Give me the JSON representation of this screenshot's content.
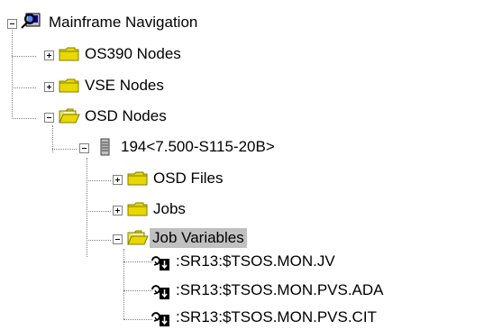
{
  "tree": {
    "root": {
      "label": "Mainframe Navigation",
      "icon": "mainframe-navigation-icon",
      "expanded": true
    },
    "os390": {
      "label": "OS390 Nodes",
      "icon": "folder-icon",
      "expanded": false
    },
    "vse": {
      "label": "VSE Nodes",
      "icon": "folder-icon",
      "expanded": false
    },
    "osd": {
      "label": "OSD Nodes",
      "icon": "open-folder-icon",
      "expanded": true
    },
    "host": {
      "label": "194<7.500-S115-20B>",
      "icon": "server-icon",
      "expanded": true
    },
    "osd_files": {
      "label": "OSD Files",
      "icon": "folder-icon",
      "expanded": false
    },
    "jobs": {
      "label": "Jobs",
      "icon": "folder-icon",
      "expanded": false
    },
    "job_variables": {
      "label": "Job Variables",
      "icon": "open-folder-icon",
      "expanded": true,
      "selected": true
    },
    "job_variable_items": [
      {
        "label": ":SR13:$TSOS.MON.JV",
        "icon": "job-variable-icon"
      },
      {
        "label": ":SR13:$TSOS.MON.PVS.ADA",
        "icon": "job-variable-icon"
      },
      {
        "label": ":SR13:$TSOS.MON.PVS.CIT",
        "icon": "job-variable-icon"
      }
    ]
  },
  "colors": {
    "folder_yellow": "#e8d800",
    "folder_dark": "#808000",
    "selection": "#c0c0c0",
    "tree_lines": "#808080"
  }
}
